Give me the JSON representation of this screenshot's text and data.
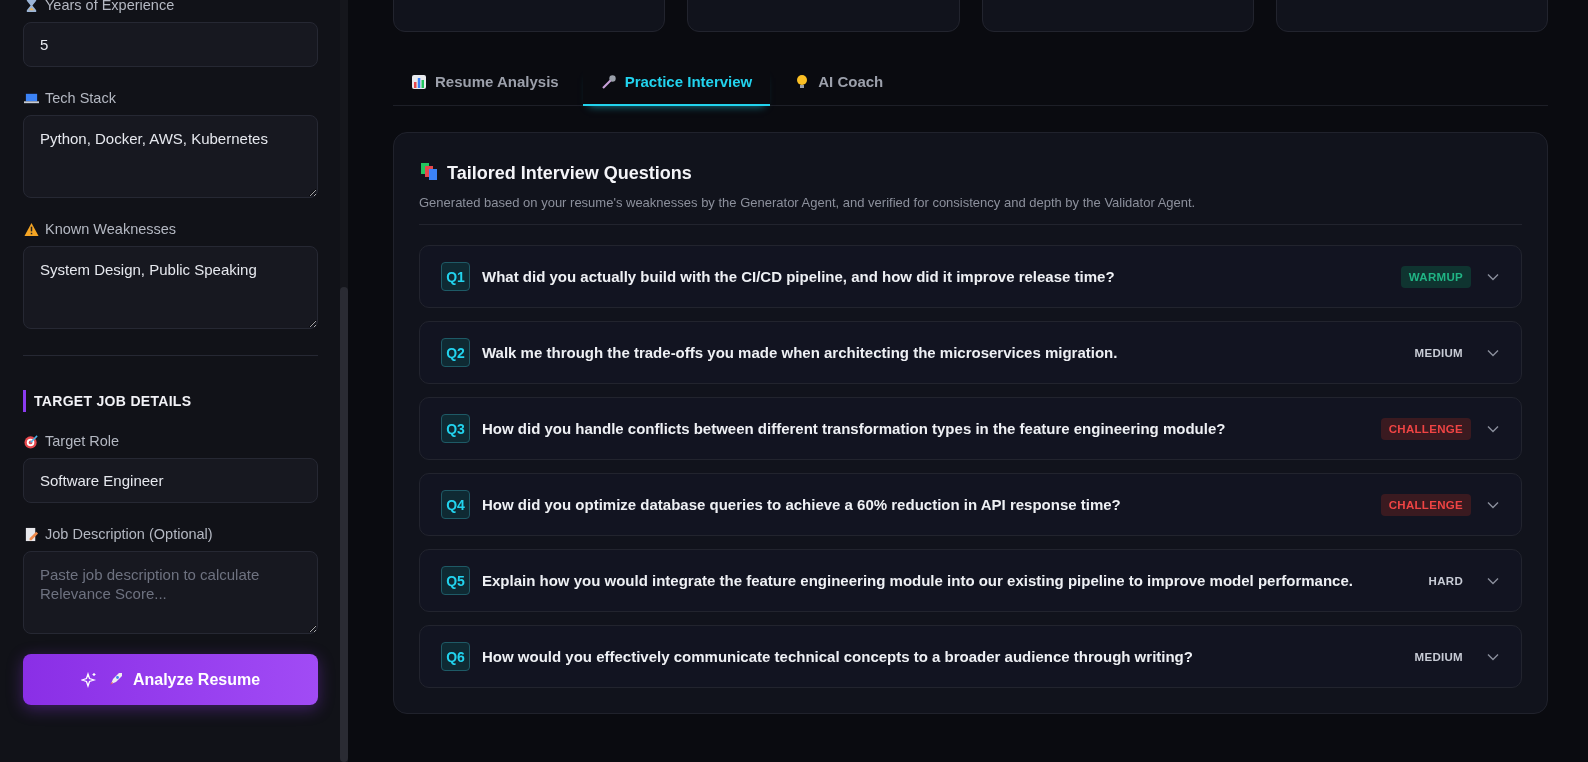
{
  "sidebar": {
    "fields": [
      {
        "label": "Years of Experience",
        "kind": "input",
        "value": "5"
      },
      {
        "label": "Tech Stack",
        "kind": "textarea",
        "value": "Python, Docker, AWS, Kubernetes"
      },
      {
        "label": "Known Weaknesses",
        "kind": "textarea",
        "value": "System Design, Public Speaking"
      }
    ],
    "section_title": "TARGET JOB DETAILS",
    "job_fields": [
      {
        "label": "Target Role",
        "kind": "input",
        "value": "Software Engineer"
      },
      {
        "label": "Job Description (Optional)",
        "kind": "textarea",
        "placeholder": "Paste job description to calculate Relevance Score..."
      }
    ],
    "button": "Analyze Resume"
  },
  "tabs": [
    {
      "label": "Resume Analysis",
      "selected": false
    },
    {
      "label": "Practice Interview",
      "selected": true
    },
    {
      "label": "AI Coach",
      "selected": false
    }
  ],
  "panel": {
    "title": "Tailored Interview Questions",
    "subtitle": "Generated based on your resume's weaknesses by the Generator Agent, and verified for consistency and depth by the Validator Agent.",
    "questions": [
      {
        "number": "Q1",
        "text": "What did you actually build with the CI/CD pipeline, and how did it improve release time?",
        "difficulty": "WARMUP",
        "kind": "warmup",
        "expanded": false
      },
      {
        "number": "Q2",
        "text": "Walk me through the trade-offs you made when architecting the microservices migration.",
        "difficulty": "MEDIUM",
        "kind": "medium",
        "expanded": false
      },
      {
        "number": "Q3",
        "text": "How did you handle conflicts between different transformation types in the feature engineering module?",
        "difficulty": "CHALLENGE",
        "kind": "challenge",
        "expanded": false
      },
      {
        "number": "Q4",
        "text": "How did you optimize database queries to achieve a 60% reduction in API response time?",
        "difficulty": "CHALLENGE",
        "kind": "challenge",
        "expanded": false
      },
      {
        "number": "Q5",
        "text": "Explain how you would integrate the feature engineering module into our existing pipeline to improve model performance.",
        "difficulty": "HARD",
        "kind": "hard",
        "expanded": false
      },
      {
        "number": "Q6",
        "text": "How would you effectively communicate technical concepts to a broader audience through writing?",
        "difficulty": "MEDIUM",
        "kind": "medium",
        "expanded": false
      }
    ]
  }
}
